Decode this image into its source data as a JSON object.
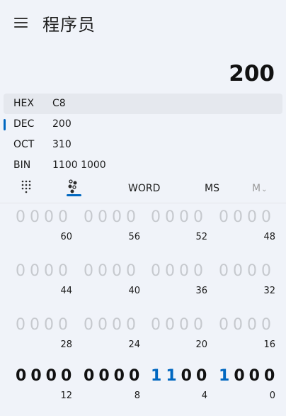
{
  "app": {
    "title": "程序员"
  },
  "display": {
    "value": "200"
  },
  "radix": [
    {
      "name": "HEX",
      "value": "C8"
    },
    {
      "name": "DEC",
      "value": "200"
    },
    {
      "name": "OCT",
      "value": "310"
    },
    {
      "name": "BIN",
      "value": "1100 1000"
    }
  ],
  "modebar": {
    "word": "WORD",
    "ms": "MS",
    "m": "M"
  },
  "bitrows": [
    {
      "groups": [
        {
          "bits": "0000",
          "pos": "60"
        },
        {
          "bits": "0000",
          "pos": "56"
        },
        {
          "bits": "0000",
          "pos": "52"
        },
        {
          "bits": "0000",
          "pos": "48"
        }
      ]
    },
    {
      "groups": [
        {
          "bits": "0000",
          "pos": "44"
        },
        {
          "bits": "0000",
          "pos": "40"
        },
        {
          "bits": "0000",
          "pos": "36"
        },
        {
          "bits": "0000",
          "pos": "32"
        }
      ]
    },
    {
      "groups": [
        {
          "bits": "0000",
          "pos": "28"
        },
        {
          "bits": "0000",
          "pos": "24"
        },
        {
          "bits": "0000",
          "pos": "20"
        },
        {
          "bits": "0000",
          "pos": "16"
        }
      ]
    },
    {
      "groups": [
        {
          "bits": "0000",
          "pos": "12"
        },
        {
          "bits": "0000",
          "pos": "8"
        },
        {
          "bits": "1100",
          "pos": "4"
        },
        {
          "bits": "1000",
          "pos": "0"
        }
      ]
    }
  ],
  "colors": {
    "accent": "#0067c0",
    "background": "#f0f3f9",
    "inactive_bit": "#c6c9ce"
  },
  "icons": {
    "menu": "hamburger-icon",
    "keypad": "keypad-icon",
    "bitflip": "bit-flip-icon",
    "memory_dropdown": "chevron-down-icon"
  }
}
